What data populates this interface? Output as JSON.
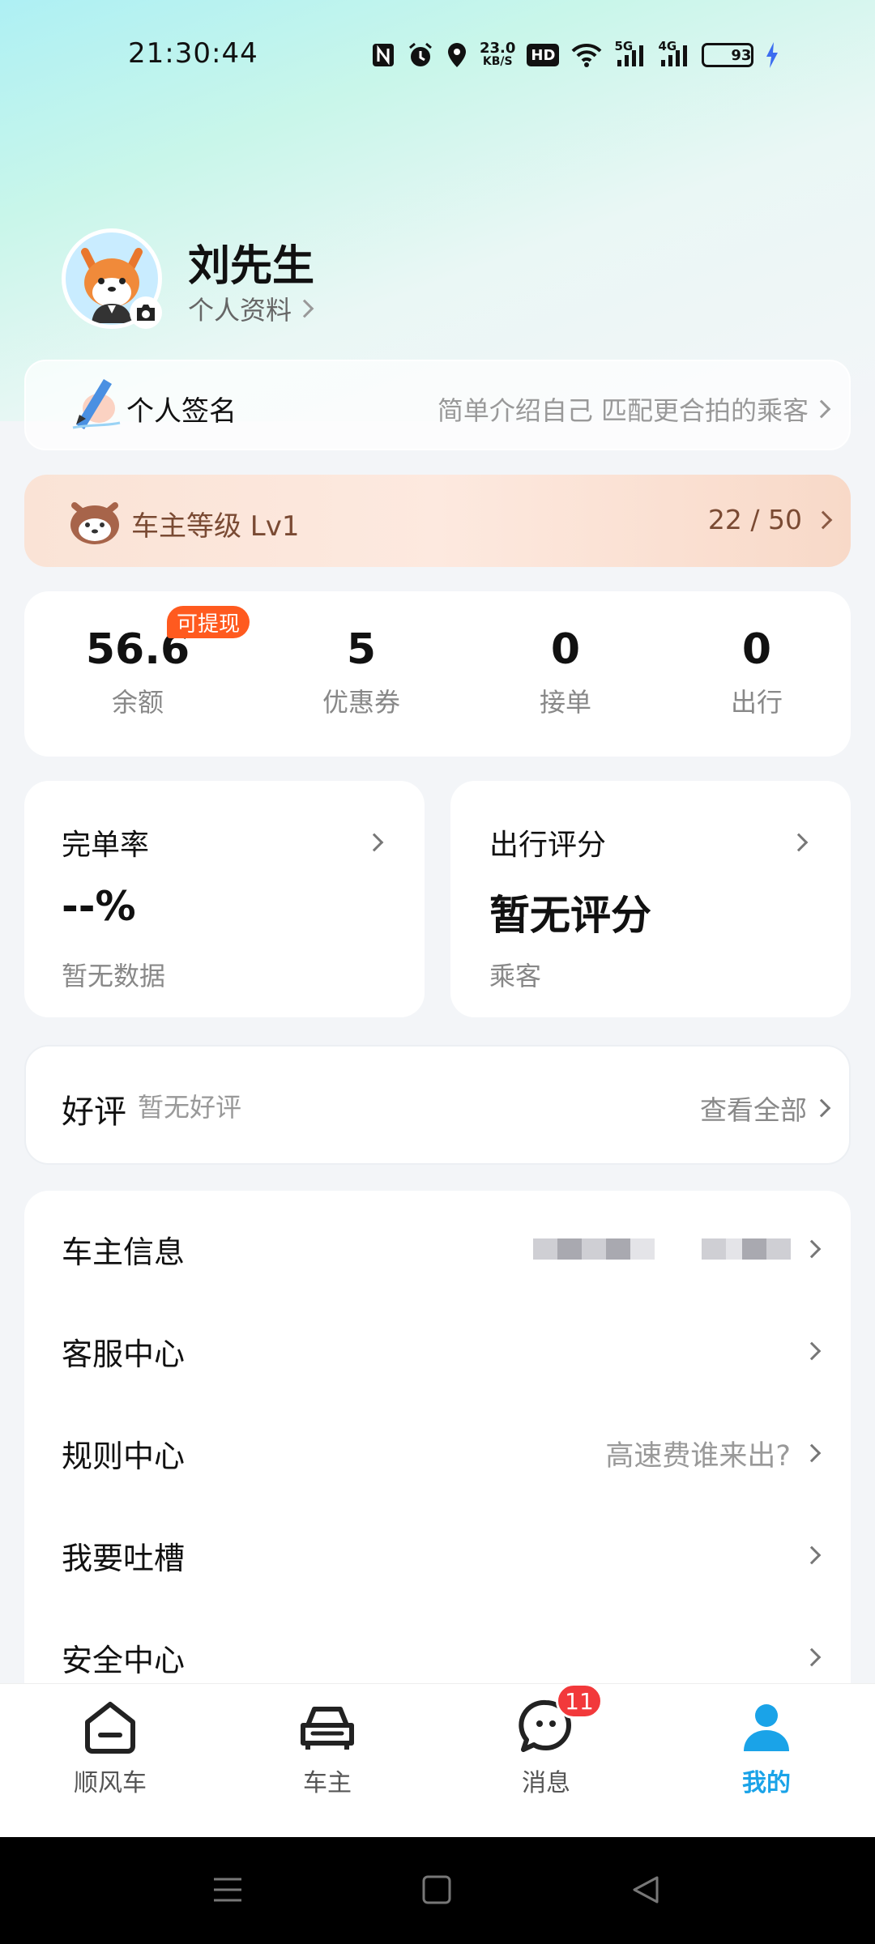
{
  "status_bar": {
    "time": "21:30:44",
    "net_speed_value": "23.0",
    "net_speed_unit": "KB/S",
    "hd_label": "HD",
    "signal_5g": "5G",
    "signal_4g": "4G",
    "battery": "93"
  },
  "profile": {
    "name": "刘先生",
    "profile_link": "个人资料"
  },
  "signature": {
    "title": "个人签名",
    "hint": "简单介绍自己 匹配更合拍的乘客"
  },
  "level": {
    "label": "车主等级 Lv1",
    "progress": "22 / 50",
    "progress_value": 22,
    "progress_max": 50
  },
  "stats": {
    "withdraw_badge": "可提现",
    "items": [
      {
        "value": "56.6",
        "label": "余额"
      },
      {
        "value": "5",
        "label": "优惠券"
      },
      {
        "value": "0",
        "label": "接单"
      },
      {
        "value": "0",
        "label": "出行"
      }
    ]
  },
  "metrics": {
    "completion": {
      "title": "完单率",
      "value": "--%",
      "sub": "暂无数据"
    },
    "rating": {
      "title": "出行评分",
      "value": "暂无评分",
      "sub": "乘客"
    }
  },
  "reviews": {
    "title": "好评",
    "empty": "暂无好评",
    "view_all": "查看全部"
  },
  "menu": {
    "items": [
      {
        "label": "车主信息",
        "right": ""
      },
      {
        "label": "客服中心",
        "right": ""
      },
      {
        "label": "规则中心",
        "right": "高速费谁来出?"
      },
      {
        "label": "我要吐槽",
        "right": ""
      },
      {
        "label": "安全中心",
        "right": ""
      }
    ]
  },
  "nav": {
    "tabs": [
      {
        "label": "顺风车",
        "active": false
      },
      {
        "label": "车主",
        "active": false
      },
      {
        "label": "消息",
        "active": false
      },
      {
        "label": "我的",
        "active": true
      }
    ],
    "message_badge": "11"
  },
  "colors": {
    "accent": "#1aa3e8",
    "badge_red": "#f2393b",
    "withdraw_orange": "#ff5a1f",
    "level_brown": "#7a4a33"
  }
}
